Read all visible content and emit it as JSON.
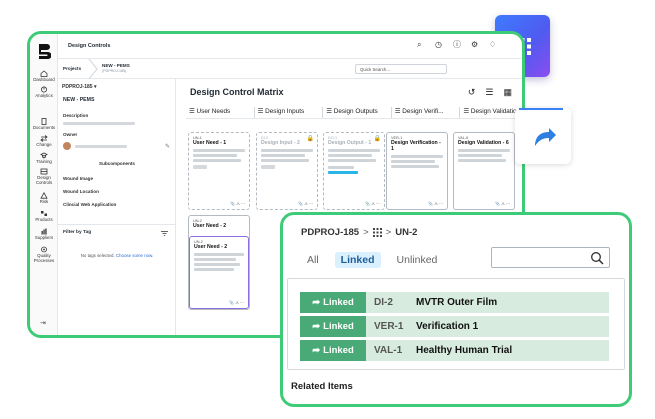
{
  "app": {
    "title": "Design Controls",
    "search_placeholder": "Quick Search..."
  },
  "sidebar": {
    "items": [
      {
        "label": "Dashboard",
        "icon": "home-icon"
      },
      {
        "label": "Analytics",
        "icon": "analytics-icon"
      },
      {
        "label": "Documents",
        "icon": "document-icon"
      },
      {
        "label": "Change",
        "icon": "change-icon"
      },
      {
        "label": "Training",
        "icon": "training-icon"
      },
      {
        "label": "Design Controls",
        "icon": "design-controls-icon"
      },
      {
        "label": "Risk",
        "icon": "risk-icon"
      },
      {
        "label": "Products",
        "icon": "products-icon"
      },
      {
        "label": "Suppliers",
        "icon": "suppliers-icon"
      },
      {
        "label": "Quality Processes",
        "icon": "quality-icon"
      }
    ],
    "collapse_icon": "collapse-icon"
  },
  "breadcrumb": {
    "root": "Projects",
    "project": "NEW - PEMS",
    "project_sub": "(PDPROJ-185)"
  },
  "left_panel": {
    "project_id": "PDPROJ-185",
    "project_title": "NEW - PEMS",
    "description_label": "Description",
    "owner_label": "Owner",
    "subcomponents_label": "Subcomponents",
    "subcomponents": [
      "Wound Image",
      "Wound Location",
      "Clincial Web Application"
    ],
    "filter_label": "Filter by Tag",
    "no_tags_text": "No tags selected.",
    "choose_link": "Choose some now."
  },
  "matrix": {
    "title": "Design Control Matrix",
    "columns": [
      "User Needs",
      "Design Inputs",
      "Design Outputs",
      "Design Verifi...",
      "Design Validation"
    ],
    "cards": [
      {
        "id": "UN-1",
        "name": "User Need - 1"
      },
      {
        "id": "DI-2",
        "name": "Design Input - 2"
      },
      {
        "id": "DO-1",
        "name": "Design Output - 1"
      },
      {
        "id": "VER-1",
        "name": "Design Verification - 1"
      },
      {
        "id": "VAL-6",
        "name": "Design Validation - 6"
      },
      {
        "id": "UN-2",
        "name": "User Need - 2"
      },
      {
        "id": "UN-2",
        "name": "User Need - 2"
      }
    ]
  },
  "popup": {
    "breadcrumb_project": "PDPROJ-185",
    "breadcrumb_item": "UN-2",
    "tabs": [
      {
        "label": "All",
        "active": false
      },
      {
        "label": "Linked",
        "active": true
      },
      {
        "label": "Unlinked",
        "active": false
      }
    ],
    "linked_items": [
      {
        "button": "Linked",
        "id": "DI-2",
        "name": "MVTR Outer Film"
      },
      {
        "button": "Linked",
        "id": "VER-1",
        "name": "Verification 1"
      },
      {
        "button": "Linked",
        "id": "VAL-1",
        "name": "Healthy Human Trial"
      }
    ],
    "related_label": "Related Items"
  },
  "colors": {
    "accent_green": "#3ecb77",
    "linked_green": "#4aaa77",
    "linked_row_bg": "#d7ecdf",
    "tab_active_bg": "#dbf0ff",
    "tile_gradient_start": "#3e7bff",
    "tile_gradient_end": "#8b4df0"
  }
}
